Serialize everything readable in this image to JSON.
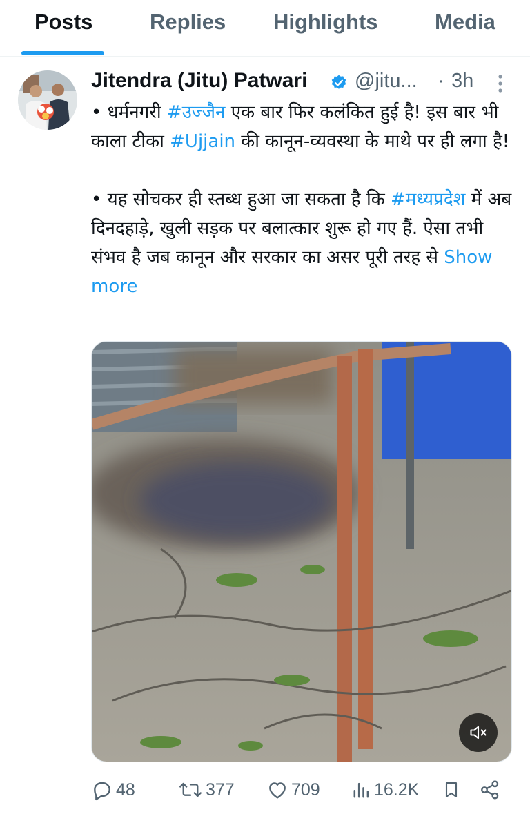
{
  "tabs": [
    {
      "label": "Posts",
      "active": true
    },
    {
      "label": "Replies",
      "active": false
    },
    {
      "label": "Highlights",
      "active": false
    },
    {
      "label": "Media",
      "active": false
    }
  ],
  "post": {
    "author_name": "Jitendra (Jitu) Patwari",
    "verified": true,
    "handle": "@jitu...",
    "separator": "·",
    "timestamp": "3h",
    "text": {
      "p1_prefix": "• धर्मनगरी ",
      "p1_tag1": "#उज्जैन",
      "p1_mid": " एक बार फिर कलंकित हुई है! इस बार भी काला टीका ",
      "p1_tag2": "#Ujjain",
      "p1_suffix": " की कानून-व्यवस्था के माथे पर ही लगा है!",
      "p2_prefix": "• यह सोचकर ही स्तब्ध हुआ जा सकता है कि ",
      "p2_tag": "#मध्यप्रदेश",
      "p2_suffix": " में अब दिनदहाड़े, खुली सड़क पर बलात्कार शुरू हो गए हैं. ऐसा तभी संभव है जब कानून और सरकार का असर पूरी तरह से ",
      "show_more": "Show more"
    },
    "media": {
      "type": "video",
      "muted": true
    },
    "stats": {
      "replies": "48",
      "reposts": "377",
      "likes": "709",
      "views": "16.2K"
    }
  },
  "icons": {
    "verified": "verified-badge-icon",
    "more": "more-vertical-icon",
    "reply": "reply-icon",
    "repost": "repost-icon",
    "like": "heart-icon",
    "views": "views-icon",
    "bookmark": "bookmark-icon",
    "share": "share-icon",
    "mute": "volume-muted-icon"
  },
  "colors": {
    "accent": "#1d9bf0",
    "text": "#0f1419",
    "muted": "#536471"
  }
}
